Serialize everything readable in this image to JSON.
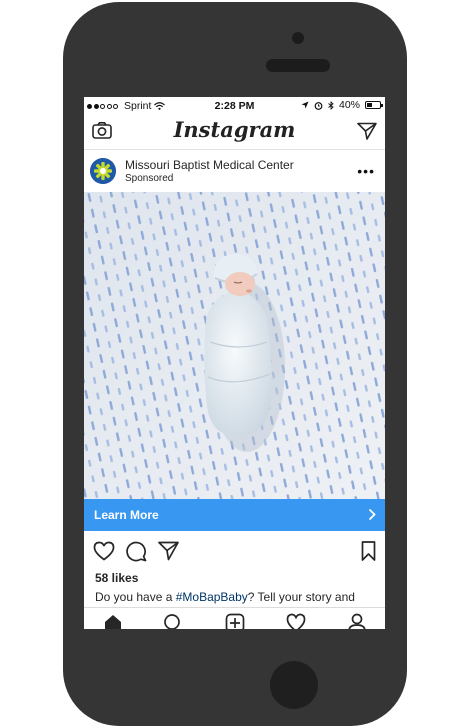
{
  "status_bar": {
    "carrier": "Sprint",
    "time": "2:28 PM",
    "battery_percent": "40%",
    "battery_level": 0.4,
    "signal_bars": 2
  },
  "header": {
    "app_name": "Instagram",
    "left_icon": "camera-icon",
    "right_icon": "direct-send-icon"
  },
  "post": {
    "account_name": "Missouri Baptist Medical Center",
    "label": "Sponsored",
    "image_description_icon": "baby-photo",
    "cta_label": "Learn More",
    "likes": "58 likes",
    "caption_start": "Do you have a ",
    "caption_hashtag": "#MoBapBaby",
    "caption_end": "? Tell your story and"
  },
  "colors": {
    "cta_background": "#3897f0",
    "phone_body": "#353535",
    "hashtag": "#003569",
    "brand_logo": "#1f5aa6"
  },
  "tab_bar": {
    "items": [
      "home-icon",
      "search-icon",
      "add-post-icon",
      "activity-icon",
      "profile-icon"
    ]
  }
}
